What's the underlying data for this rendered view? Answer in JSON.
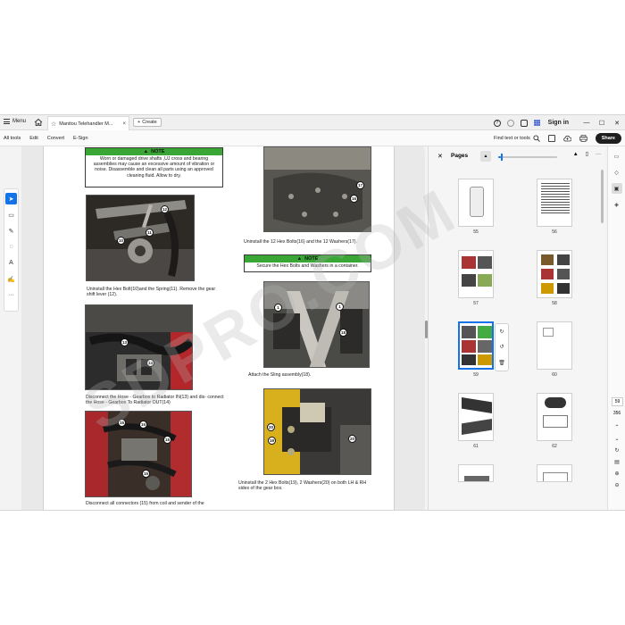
{
  "titlebar": {
    "menu_label": "Menu",
    "tab_title": "Manitou Telehandler M...",
    "tab_close": "×",
    "create_label": "Create",
    "sign_in": "Sign in"
  },
  "toolbar": {
    "items": [
      "All tools",
      "Edit",
      "Convert",
      "E-Sign"
    ],
    "find_label": "Find text or tools",
    "share_label": "Share"
  },
  "document": {
    "note1": {
      "heading": "NOTE",
      "text": "Worn or damaged drive shafts ,UJ cross and bearing assemblies may cause an excessive amount of vibration or noise. Disassemble and clean all parts using an approved cleaning fluid. Allow to dry."
    },
    "note2": {
      "heading": "NOTE",
      "text": "Secure the Hex Bolts and Washers in a container."
    },
    "captions": {
      "c1": "Uninstall the Hex Bolt(10)and the Spring(11). Remove the gear shift lever (12).",
      "c2": "Disconnect the Hose - Gearbox to Radiator IN(13) and dis- connect the Hose - Gearbox To Radiator OUT(14)",
      "c3": "Disconnect all connectors (15) from coil and sender of the",
      "c4": "Uninstall the 12 Hex Bolts(16) and the 12 Washers(17).",
      "c5": "Attach the Sling assembly(18).",
      "c6": "Uninstall the 2 Hex Bolts(19), 2 Washers(20) on both LH & RH sides of the gear box."
    },
    "callouts": {
      "p1": [
        "12",
        "11",
        "10"
      ],
      "p2": [
        "13",
        "14"
      ],
      "p3": [
        "15",
        "15",
        "15",
        "15"
      ],
      "p4": [
        "17",
        "16"
      ],
      "p5": [
        "1",
        "1",
        "18"
      ],
      "p6": [
        "20",
        "19",
        "20"
      ]
    },
    "watermark": "SDPRO.COM"
  },
  "pages_panel": {
    "title": "Pages",
    "zoom_fraction": 0.05,
    "thumbnails": [
      {
        "num": "55"
      },
      {
        "num": "56"
      },
      {
        "num": "57"
      },
      {
        "num": "58"
      },
      {
        "num": "59"
      },
      {
        "num": "60"
      },
      {
        "num": "61"
      },
      {
        "num": "62"
      },
      {
        "num": "",
        "partial": true
      },
      {
        "num": "",
        "partial": true
      }
    ],
    "selected_page": "59"
  },
  "navigation": {
    "current_page": "59",
    "total_pages": "356"
  },
  "colors": {
    "accent": "#1473e6",
    "note_header": "#3aa635"
  }
}
